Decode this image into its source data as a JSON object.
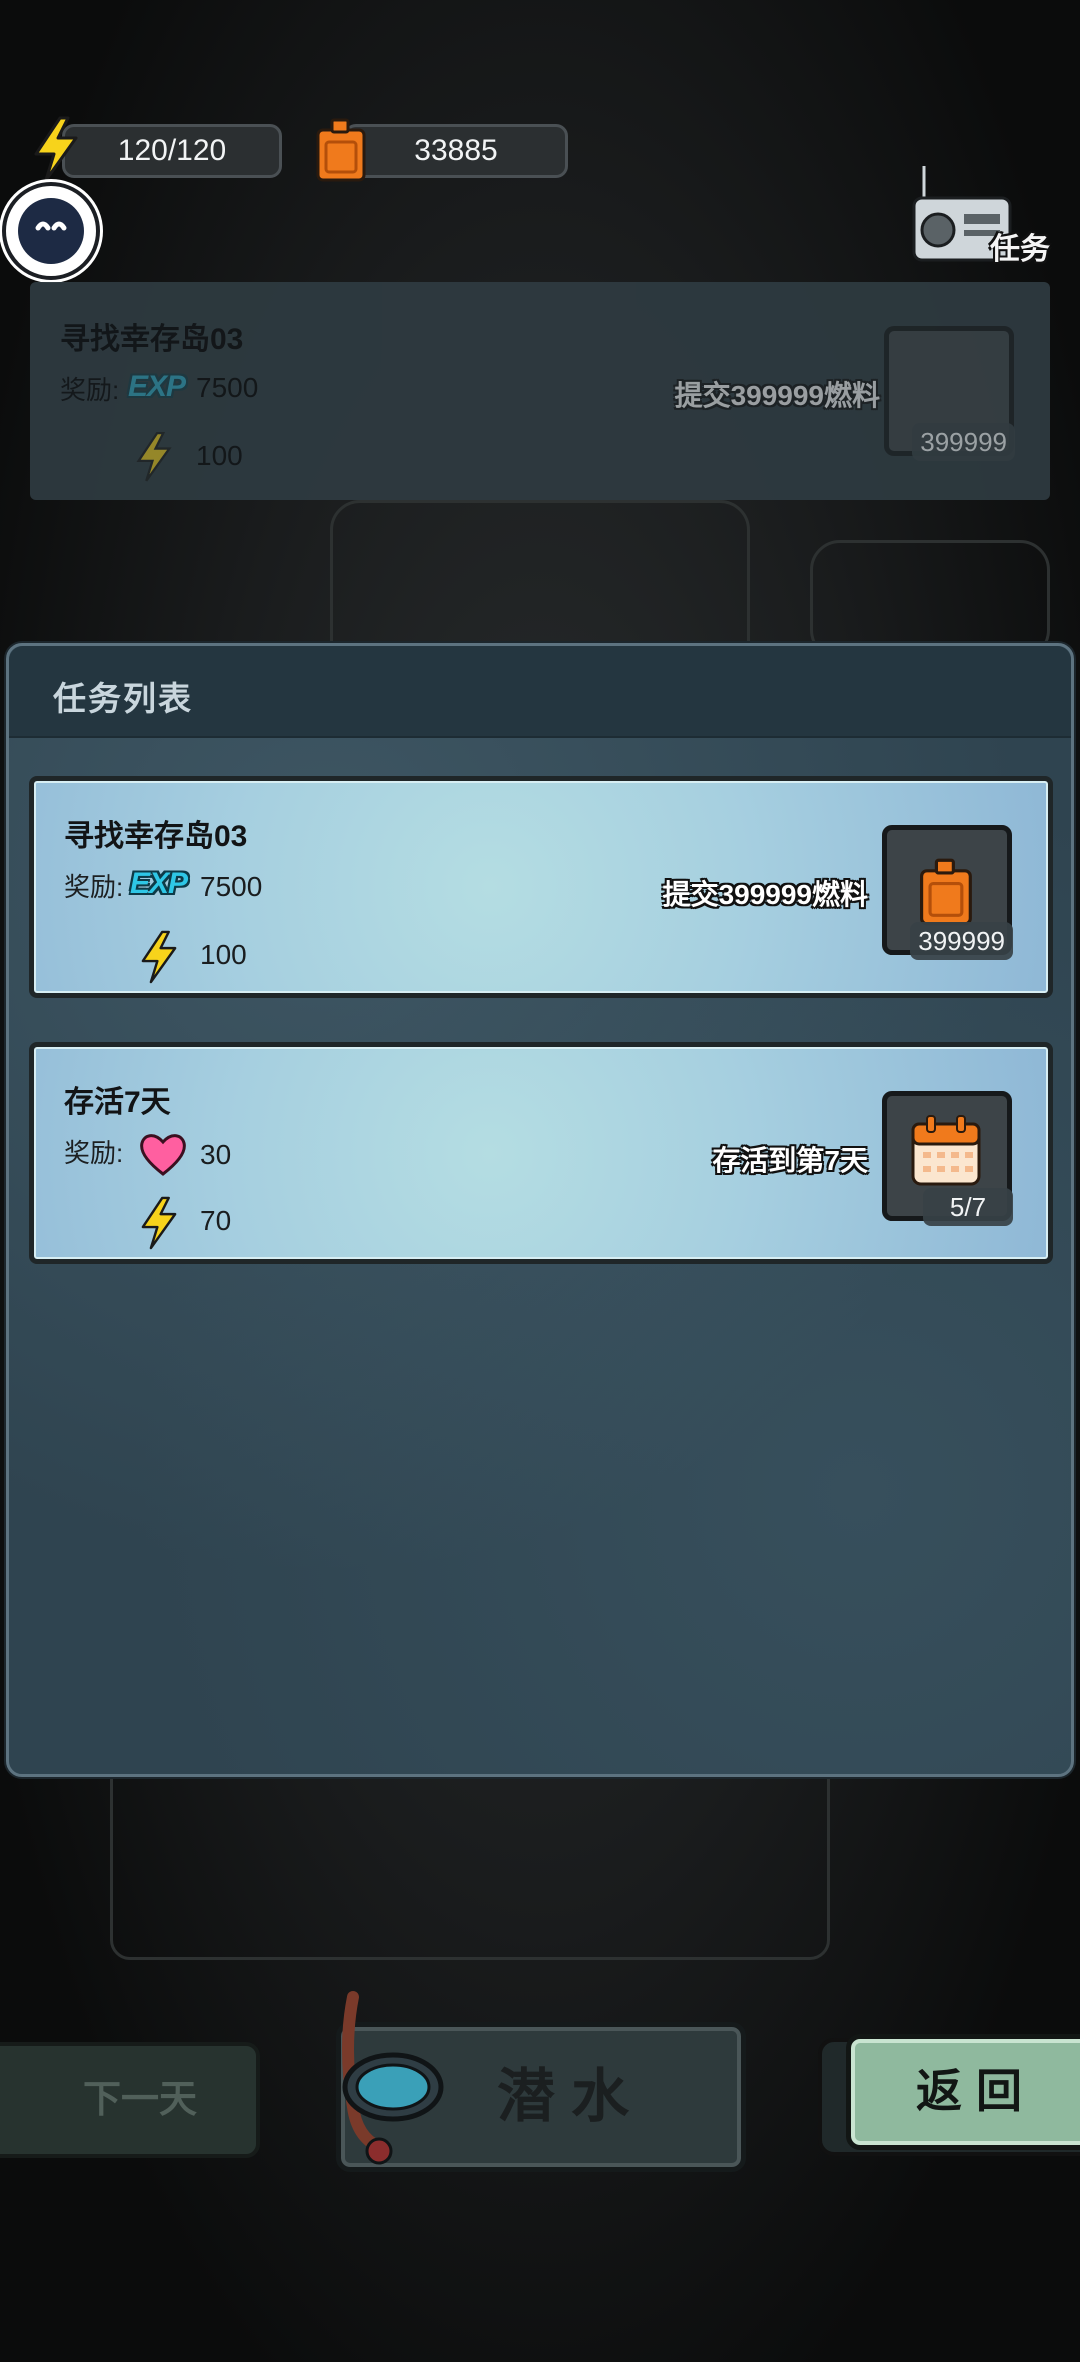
{
  "hud": {
    "energy": "120/120",
    "fuel": "33885"
  },
  "radio": {
    "label": "任务"
  },
  "background_quest": {
    "title": "寻找幸存岛03",
    "reward_label": "奖励:",
    "exp_badge": "EXP",
    "exp_value": "7500",
    "energy_value": "100",
    "requirement": "提交399999燃料",
    "count": "399999"
  },
  "panel": {
    "title": "任务列表",
    "quests": [
      {
        "title": "寻找幸存岛03",
        "reward_label": "奖励:",
        "reward_1_icon": "exp-badge",
        "exp_badge": "EXP",
        "reward_1_value": "7500",
        "reward_2_icon": "lightning-icon",
        "reward_2_value": "100",
        "requirement": "提交399999燃料",
        "slot_icon": "fuel-can-icon",
        "count": "399999"
      },
      {
        "title": "存活7天",
        "reward_label": "奖励:",
        "reward_1_icon": "heart-icon",
        "reward_1_value": "30",
        "reward_2_icon": "lightning-icon",
        "reward_2_value": "70",
        "requirement": "存活到第7天",
        "slot_icon": "calendar-icon",
        "count": "5/7"
      }
    ]
  },
  "buttons": {
    "next_day": "下一天",
    "dive": "潜水",
    "back": "返回"
  },
  "colors": {
    "card_bg": "#a6cfe0",
    "panel_bg": "#2f4450",
    "back_button": "#8fb99e",
    "fuel_orange": "#f07a1c",
    "energy_yellow": "#f7d31b",
    "exp_cyan": "#2ec7e6",
    "heart_pink": "#ff5fa0"
  }
}
